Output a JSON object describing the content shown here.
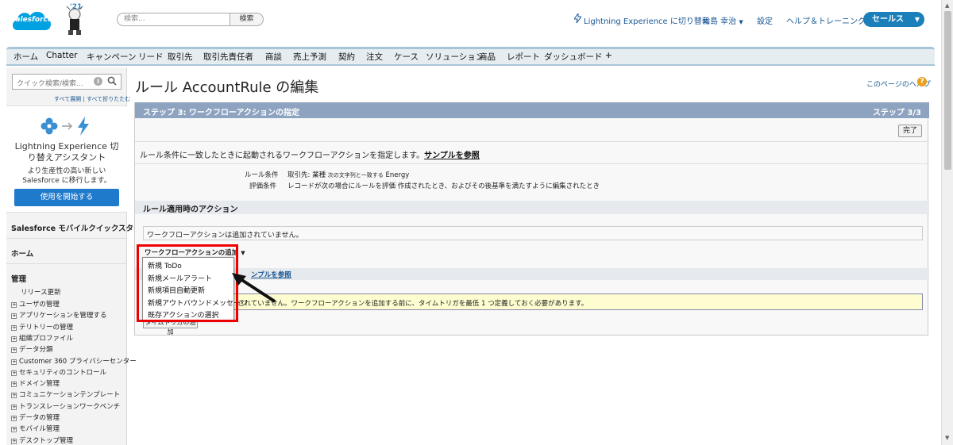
{
  "header": {
    "logo_text": "salesforce",
    "mascot_year": "'21",
    "search_placeholder": "検索...",
    "search_button": "検索",
    "lightning_switch": "Lightning Experience に切り替え",
    "user_name": "輪島 幸治",
    "setup": "設定",
    "help_training": "ヘルプ＆トレーニング",
    "app_name": "セールス"
  },
  "tabs": [
    "ホーム",
    "Chatter",
    "キャンペーン",
    "リード",
    "取引先",
    "取引先責任者",
    "商談",
    "売上予測",
    "契約",
    "注文",
    "ケース",
    "ソリューション",
    "商品",
    "レポート",
    "ダッシュボード",
    "+"
  ],
  "sidebar": {
    "quick_search_placeholder": "クイック検索/検索...",
    "expand_all": "すべて展開",
    "collapse_all": "すべて折りたたむ",
    "le_title": "Lightning Experience 切り替えアシスタント",
    "le_sub": "より生産性の高い新しい Salesforce に移行します。",
    "le_button": "使用を開始する",
    "mobile_quickstart": "Salesforce モバイルクイックスタート",
    "home": "ホーム",
    "admin": "管理",
    "release_update": "リリース更新",
    "items": [
      "ユーザの管理",
      "アプリケーションを管理する",
      "テリトリーの管理",
      "組織プロファイル",
      "データ分類",
      "Customer 360 プライバシーセンター",
      "セキュリティのコントロール",
      "ドメイン管理",
      "コミュニケーションテンプレート",
      "トランスレーションワークベンチ",
      "データの管理",
      "モバイル管理",
      "デスクトップ管理"
    ]
  },
  "main": {
    "page_title": "ルール AccountRule の編集",
    "help_link": "このページのヘルプ",
    "step_title": "ステップ 3: ワークフローアクションの指定",
    "step_num": "ステップ 3/3",
    "done": "完了",
    "desc": "ルール条件に一致したときに起動されるワークフローアクションを指定します。",
    "desc_link": "サンプルを参照",
    "rule_cond_label": "ルール条件",
    "rule_cond_value_a": "取引先: 業種",
    "rule_cond_value_b": "次の文字列と一致する",
    "rule_cond_value_c": "Energy",
    "eval_label": "評価条件",
    "eval_value": "レコードが次の場合にルールを評価 作成されたとき、およびその後基準を満たすように編集されたとき",
    "actions_heading": "ルール適用時のアクション",
    "no_actions": "ワークフローアクションは追加されていません。",
    "add_action": "ワークフローアクションの追加",
    "sample_link": "ンプルを参照",
    "warn_text": "されていません。ワークフローアクションを追加する前に、タイムトリガを最低 1 つ定義しておく必要があります。",
    "add_time_trigger": "タイムトリガの追加"
  },
  "dropdown": [
    "新規 ToDo",
    "新規メールアラート",
    "新規項目自動更新",
    "新規アウトバウンドメッセージ",
    "既存アクションの選択"
  ],
  "colors": {
    "brand": "#00a1e0",
    "tab_border": "#a6c6d8",
    "step_bar": "#8ea3c0",
    "highlight": "#e00000",
    "button": "#1f7acc"
  }
}
